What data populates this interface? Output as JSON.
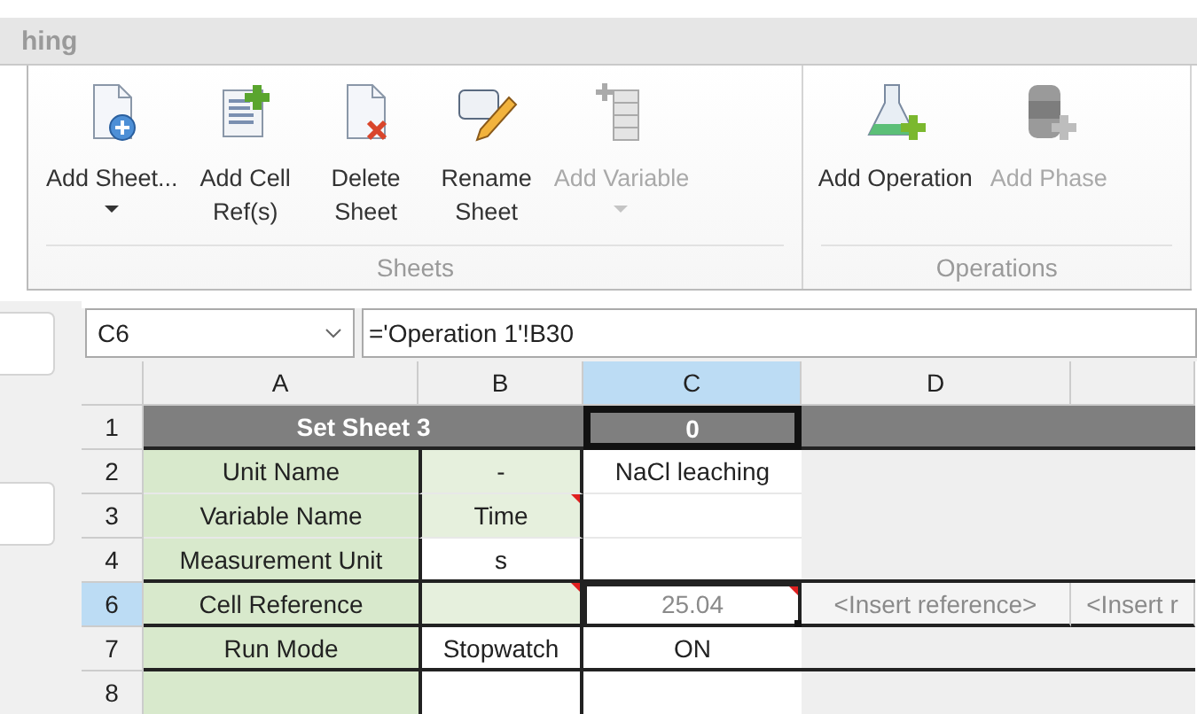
{
  "window": {
    "title": "hing"
  },
  "ribbon": {
    "groups": [
      {
        "label": "Sheets",
        "buttons": [
          {
            "kind": "sheet",
            "label": "Add Sheet...",
            "disabled": false,
            "dropdown": true
          },
          {
            "kind": "refs",
            "label": "Add Cell Ref(s)",
            "disabled": false,
            "dropdown": false
          },
          {
            "kind": "delete",
            "label": "Delete Sheet",
            "disabled": false,
            "dropdown": false
          },
          {
            "kind": "rename",
            "label": "Rename Sheet",
            "disabled": false,
            "dropdown": false
          },
          {
            "kind": "variable",
            "label": "Add Variable",
            "disabled": true,
            "dropdown": true
          }
        ]
      },
      {
        "label": "Operations",
        "buttons": [
          {
            "kind": "flask",
            "label": "Add Operation",
            "disabled": false,
            "dropdown": false
          },
          {
            "kind": "phase",
            "label": "Add Phase",
            "disabled": true,
            "dropdown": false
          }
        ]
      }
    ]
  },
  "name_box": {
    "value": "C6"
  },
  "formula_bar": {
    "value": "='Operation 1'!B30"
  },
  "columns": [
    {
      "label": "A",
      "selected": false
    },
    {
      "label": "B",
      "selected": false
    },
    {
      "label": "C",
      "selected": true
    },
    {
      "label": "D",
      "selected": false
    },
    {
      "selected": false
    }
  ],
  "rows": [
    {
      "number": "1",
      "selected": false,
      "cells": [
        {
          "text": "Set Sheet 3",
          "kind": "title",
          "merged": true,
          "selected": false
        },
        {
          "text": "0",
          "kind": "title",
          "selected": false,
          "outlined": true
        },
        {
          "kind": "title",
          "selected": false
        },
        {
          "kind": "title",
          "selected": false
        }
      ]
    },
    {
      "number": "2",
      "selected": false,
      "cells": [
        {
          "text": "Unit Name",
          "kind": "label",
          "selected": false
        },
        {
          "text": "-",
          "kind": "input",
          "selected": false
        },
        {
          "text": "NaCl leaching",
          "kind": "value",
          "selected": false
        },
        {
          "kind": "empty",
          "selected": false
        },
        {
          "kind": "empty",
          "selected": false
        }
      ]
    },
    {
      "number": "3",
      "selected": false,
      "cells": [
        {
          "text": "Variable Name",
          "kind": "label",
          "selected": false
        },
        {
          "text": "Time",
          "kind": "input",
          "selected": false,
          "note": true
        },
        {
          "kind": "value",
          "selected": false
        },
        {
          "kind": "empty",
          "selected": false
        },
        {
          "kind": "empty",
          "selected": false
        }
      ]
    },
    {
      "number": "4",
      "selected": false,
      "cells": [
        {
          "text": "Measurement Unit",
          "kind": "label",
          "selected": false
        },
        {
          "text": "s",
          "kind": "value",
          "selected": false
        },
        {
          "kind": "value",
          "selected": false
        },
        {
          "kind": "empty",
          "selected": false
        },
        {
          "kind": "empty",
          "selected": false
        }
      ]
    },
    {
      "number": "6",
      "selected": true,
      "cells": [
        {
          "text": "Cell Reference",
          "kind": "label",
          "selected": false
        },
        {
          "kind": "input",
          "selected": false,
          "note": true
        },
        {
          "text": "25.04",
          "kind": "muted",
          "selected": true,
          "note": true
        },
        {
          "text": "<Insert reference>",
          "kind": "muted",
          "selected": false
        },
        {
          "text": "<Insert r",
          "kind": "muted",
          "selected": false
        }
      ]
    },
    {
      "number": "7",
      "selected": false,
      "cells": [
        {
          "text": "Run Mode",
          "kind": "label",
          "selected": false
        },
        {
          "text": "Stopwatch",
          "kind": "value",
          "selected": false
        },
        {
          "text": "ON",
          "kind": "value",
          "selected": false
        },
        {
          "kind": "empty",
          "selected": false
        },
        {
          "kind": "empty",
          "selected": false
        }
      ]
    },
    {
      "number": "8",
      "selected": false,
      "cells": [
        {
          "kind": "label",
          "selected": false
        },
        {
          "kind": "value",
          "selected": false
        },
        {
          "kind": "value",
          "selected": false
        },
        {
          "kind": "empty",
          "selected": false
        },
        {
          "kind": "empty",
          "selected": false
        }
      ]
    }
  ]
}
